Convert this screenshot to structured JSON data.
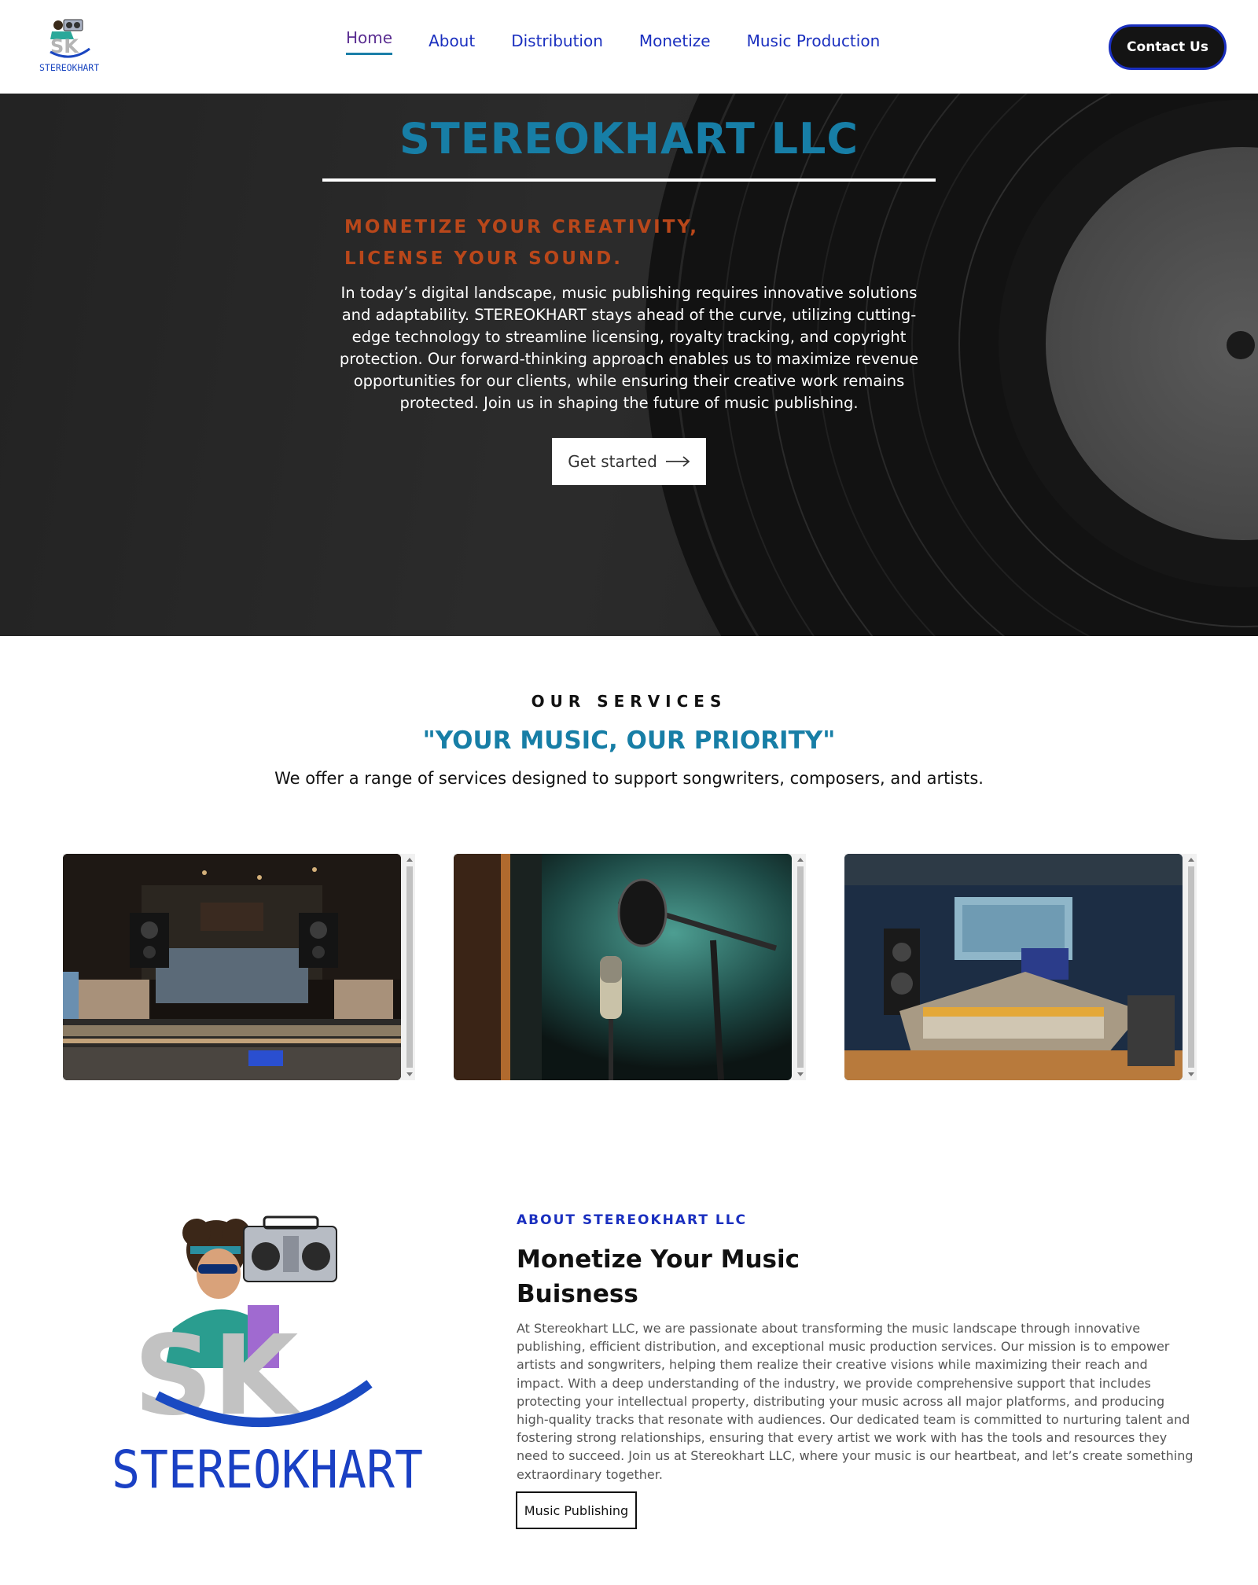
{
  "header": {
    "logo_text": "STEREOKHART",
    "nav": [
      {
        "label": "Home",
        "active": true
      },
      {
        "label": "About"
      },
      {
        "label": "Distribution"
      },
      {
        "label": "Monetize"
      },
      {
        "label": "Music Production"
      }
    ],
    "contact_label": "Contact Us"
  },
  "hero": {
    "title": "STEREOKHART LLC",
    "subtitle_line1": "MONETIZE YOUR CREATIVITY,",
    "subtitle_line2": "LICENSE YOUR SOUND.",
    "body": "In today’s digital landscape, music publishing requires innovative solutions and adaptability. STEREOKHART stays ahead of the curve, utilizing cutting-edge technology to streamline licensing, royalty tracking, and copyright protection. Our forward-thinking approach enables us to maximize revenue opportunities for our clients, while ensuring their creative work remains protected. Join us in shaping the future of music publishing.",
    "cta_label": "Get started",
    "cta_icon": "arrow-right-icon"
  },
  "services": {
    "kicker": "OUR SERVICES",
    "title": "\"YOUR MUSIC, OUR PRIORITY\"",
    "description": "We offer a range of services designed to support songwriters, composers, and artists.",
    "cards": [
      {
        "image": "recording-studio-control-room"
      },
      {
        "image": "studio-microphone"
      },
      {
        "image": "mixing-console-studio"
      }
    ]
  },
  "about": {
    "kicker": "ABOUT STEREOKHART LLC",
    "title": "Monetize Your Music Buisness",
    "body": "At Stereokhart LLC, we are passionate about transforming the music landscape through innovative publishing, efficient distribution, and exceptional music production services. Our mission is to empower artists and songwriters, helping them realize their creative visions while maximizing their reach and impact. With a deep understanding of the industry, we provide comprehensive support that includes protecting your intellectual property, distributing your music across all major platforms, and producing high-quality tracks that resonate with audiences. Our dedicated team is committed to nurturing talent and fostering strong relationships, ensuring that every artist we work with has the tools and resources they need to succeed. Join us at Stereokhart LLC, where your music is our heartbeat, and let’s create something extraordinary together.",
    "logo_letters": "SK",
    "logo_text": "STEREOKHART",
    "button_label": "Music Publishing"
  },
  "colors": {
    "nav_link": "#1a2fbf",
    "nav_active": "#5a2d91",
    "brand_teal": "#177ea6",
    "hero_orange": "#b9471a",
    "hero_bg": "#262626"
  }
}
